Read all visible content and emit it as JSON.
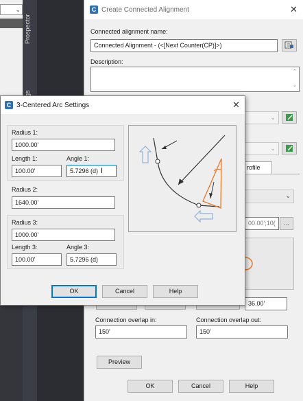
{
  "background": {
    "tab_prospector": "Prospector",
    "tab_settings": "ngs"
  },
  "main_dialog": {
    "title": "Create Connected Alignment",
    "name_label": "Connected alignment name:",
    "name_value": "Connected Alignment - (<[Next Counter(CP)]>)",
    "description_label": "Description:",
    "tab_profile": "rofile",
    "station_value": "00.00';10(",
    "browse_label": "...",
    "field_value_right": "36.00'",
    "overlap_in_label": "Connection overlap in:",
    "overlap_in_value": "150'",
    "overlap_out_label": "Connection overlap out:",
    "overlap_out_value": "150'",
    "preview_label": "Preview",
    "ok_label": "OK",
    "cancel_label": "Cancel",
    "help_label": "Help"
  },
  "arc_dialog": {
    "title": "3-Centered Arc Settings",
    "radius1_label": "Radius 1:",
    "radius1_value": "1000.00'",
    "length1_label": "Length 1:",
    "length1_value": "100.00'",
    "angle1_label": "Angle 1:",
    "angle1_value": "5.7296 (d)",
    "radius2_label": "Radius 2:",
    "radius2_value": "1640.00'",
    "radius3_label": "Radius 3:",
    "radius3_value": "1000.00'",
    "length3_label": "Length 3:",
    "length3_value": "100.00'",
    "angle3_label": "Angle 3:",
    "angle3_value": "5.7296 (d)",
    "ok_label": "OK",
    "cancel_label": "Cancel",
    "help_label": "Help"
  },
  "colors": {
    "accent": "#0078d7",
    "app_icon": "#2f6fb3",
    "arc_orange": "#e8782a",
    "direction_arrow": "#8fb3d9"
  }
}
